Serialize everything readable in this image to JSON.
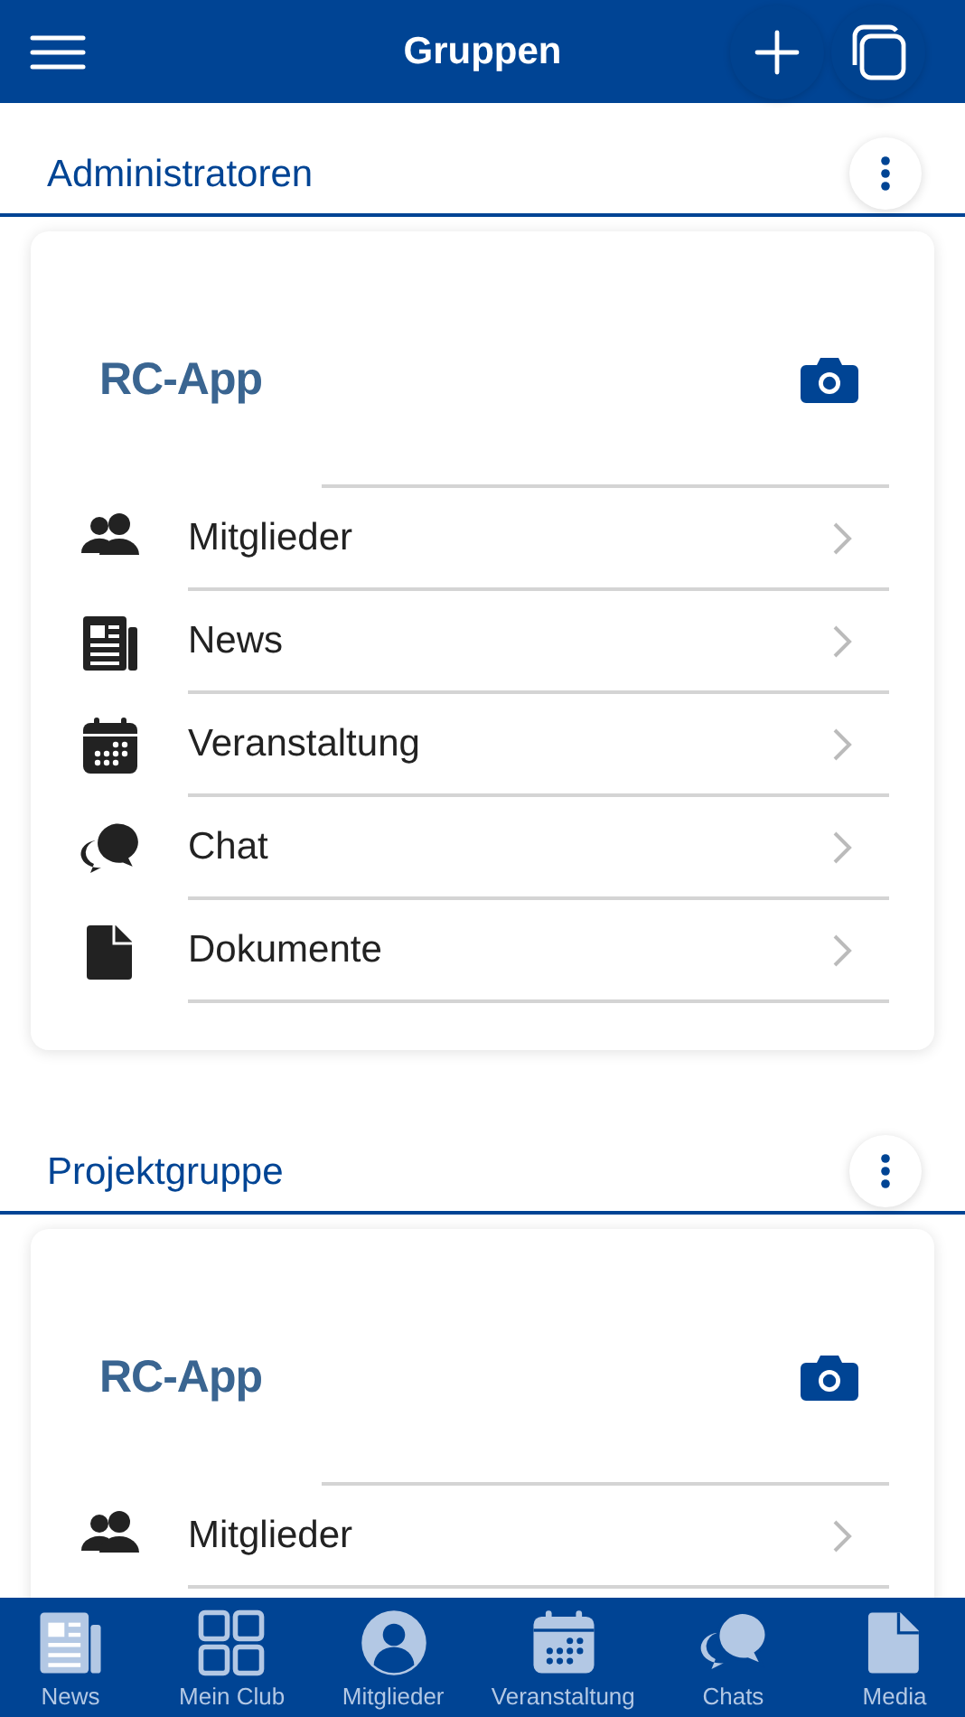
{
  "header": {
    "title": "Gruppen"
  },
  "groups": [
    {
      "name": "Administratoren",
      "logo": "RC-App",
      "items": [
        {
          "label": "Mitglieder",
          "kind": "members"
        },
        {
          "label": "News",
          "kind": "news"
        },
        {
          "label": "Veranstaltung",
          "kind": "calendar"
        },
        {
          "label": "Chat",
          "kind": "chat"
        },
        {
          "label": "Dokumente",
          "kind": "document"
        }
      ]
    },
    {
      "name": "Projektgruppe",
      "logo": "RC-App",
      "items": [
        {
          "label": "Mitglieder",
          "kind": "members"
        }
      ]
    }
  ],
  "nav": [
    {
      "label": "News",
      "kind": "news",
      "selected": false
    },
    {
      "label": "Mein Club",
      "kind": "grid",
      "selected": false
    },
    {
      "label": "Mitglieder",
      "kind": "person",
      "selected": false
    },
    {
      "label": "Veranstaltung",
      "kind": "calendar",
      "selected": false
    },
    {
      "label": "Chats",
      "kind": "chat",
      "selected": false
    },
    {
      "label": "Media",
      "kind": "document",
      "selected": false
    }
  ]
}
